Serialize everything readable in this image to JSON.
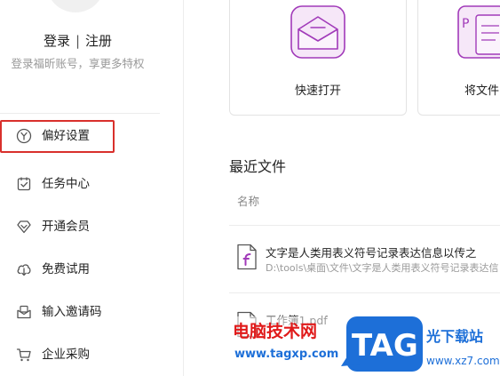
{
  "sidebar": {
    "auth": {
      "login": "登录",
      "separator": "|",
      "register": "注册"
    },
    "hint": "登录福昕账号，享更多特权",
    "items": [
      {
        "label": "偏好设置",
        "icon": "preferences-icon"
      },
      {
        "label": "任务中心",
        "icon": "task-center-icon"
      },
      {
        "label": "开通会员",
        "icon": "membership-diamond-icon"
      },
      {
        "label": "免费试用",
        "icon": "free-trial-download-icon"
      },
      {
        "label": "输入邀请码",
        "icon": "invite-code-icon"
      },
      {
        "label": "企业采购",
        "icon": "enterprise-purchase-icon"
      }
    ]
  },
  "cards": [
    {
      "label": "快速打开",
      "icon": "envelope-open-icon"
    },
    {
      "label": "将文件",
      "icon": "convert-file-icon"
    }
  ],
  "recent": {
    "title": "最近文件",
    "column_name": "名称",
    "files": [
      {
        "name": "文字是人类用表义符号记录表达信息以传之",
        "path": "D:\\tools\\桌面\\文件\\文字是人类用表义符号记录表达信",
        "icon": "pdf-file-icon"
      },
      {
        "name": "工作簿1.pdf",
        "path": "",
        "icon": "pdf-file-icon"
      }
    ]
  },
  "watermark": {
    "brand_left": "电脑技术网",
    "url_left": "www.tagxp.com",
    "logo": "TAG",
    "brand_right": "光下载站",
    "url_right": "www.xz7.com"
  },
  "colors": {
    "highlight_border": "#d9302c",
    "accent_purple": "#a13ab9",
    "watermark_red": "#e01a1a",
    "watermark_blue": "#1d6fd8"
  }
}
